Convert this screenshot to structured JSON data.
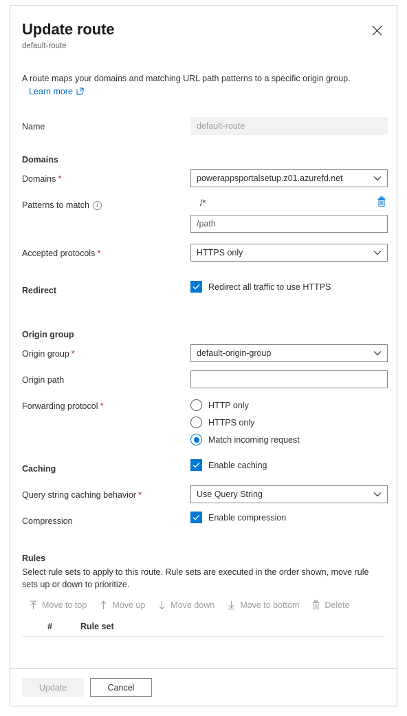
{
  "dialog": {
    "title": "Update route",
    "subtitle": "default-route",
    "close_icon": "close-icon",
    "description": "A route maps your domains and matching URL path patterns to a specific origin group.",
    "learn_more": "Learn more",
    "learn_more_icon": "external-link-icon"
  },
  "fields": {
    "name": {
      "label": "Name",
      "value": "default-route",
      "readonly": true
    }
  },
  "domains_section": {
    "heading": "Domains",
    "domains": {
      "label": "Domains",
      "required": "*",
      "value": "powerappsportalsetup.z01.azurefd.net",
      "chevron_icon": "chevron-down-icon"
    },
    "patterns": {
      "label": "Patterns to match",
      "info_icon": "info-icon",
      "entries": [
        "/*"
      ],
      "delete_icon": "trash-icon",
      "new_pattern_placeholder": "/path",
      "new_pattern_value": ""
    },
    "accepted_protocols": {
      "label": "Accepted protocols",
      "required": "*",
      "value": "HTTPS only",
      "chevron_icon": "chevron-down-icon"
    }
  },
  "redirect_section": {
    "heading": "Redirect",
    "checkbox": {
      "label": "Redirect all traffic to use HTTPS",
      "checked": true,
      "check_icon": "checkmark-icon"
    }
  },
  "origin_group_section": {
    "heading": "Origin group",
    "origin_group": {
      "label": "Origin group",
      "required": "*",
      "value": "default-origin-group",
      "chevron_icon": "chevron-down-icon"
    },
    "origin_path": {
      "label": "Origin path",
      "value": "",
      "placeholder": ""
    },
    "forwarding_protocol": {
      "label": "Forwarding protocol",
      "required": "*",
      "options": [
        {
          "label": "HTTP only",
          "selected": false
        },
        {
          "label": "HTTPS only",
          "selected": false
        },
        {
          "label": "Match incoming request",
          "selected": true
        }
      ]
    }
  },
  "caching_section": {
    "heading": "Caching",
    "enable_caching": {
      "label": "Enable caching",
      "checked": true
    },
    "query_string": {
      "label": "Query string caching behavior",
      "required": "*",
      "value": "Use Query String",
      "chevron_icon": "chevron-down-icon"
    },
    "compression": {
      "label": "Compression",
      "checkbox_label": "Enable compression",
      "checked": true
    }
  },
  "rules_section": {
    "heading": "Rules",
    "description": "Select rule sets to apply to this route. Rule sets are executed in the order shown, move rule sets up or down to prioritize.",
    "commands": [
      {
        "label": "Move to top",
        "icon": "move-to-top-icon",
        "disabled": true
      },
      {
        "label": "Move up",
        "icon": "arrow-up-icon",
        "disabled": true
      },
      {
        "label": "Move down",
        "icon": "arrow-down-icon",
        "disabled": true
      },
      {
        "label": "Move to bottom",
        "icon": "move-to-bottom-icon",
        "disabled": true
      },
      {
        "label": "Delete",
        "icon": "trash-icon",
        "disabled": true
      }
    ],
    "table": {
      "columns": [
        "#",
        "Rule set"
      ],
      "rows": []
    }
  },
  "footer": {
    "update_label": "Update",
    "update_disabled": true,
    "cancel_label": "Cancel"
  },
  "colors": {
    "accent": "#0078d4",
    "link": "#0066cc",
    "required": "#a4262c",
    "disabled_text": "#a19f9d",
    "border": "#8a8886",
    "panel_border": "#c8c6c4"
  }
}
